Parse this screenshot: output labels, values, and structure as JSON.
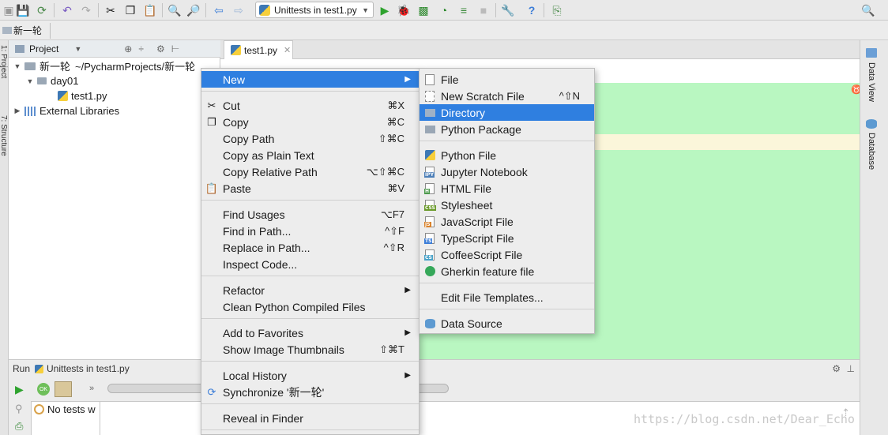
{
  "toolbar": {
    "run_config_label": "Unittests in test1.py"
  },
  "breadcrumb": {
    "label": "新一轮"
  },
  "left_strip": {
    "project_label": "1: Project",
    "structure_label": "7: Structure"
  },
  "project_panel": {
    "header_label": "Project",
    "tree": [
      {
        "label": "新一轮",
        "detail": "~/PycharmProjects/新一轮"
      },
      {
        "label": "day01"
      },
      {
        "label": "test1.py"
      },
      {
        "label": "External Libraries"
      }
    ]
  },
  "editor": {
    "tab_label": "test1.py"
  },
  "right_strip": {
    "data_view_label": "Data View",
    "database_label": "Database"
  },
  "run_panel": {
    "title": "Run",
    "config": "Unittests in test1.py",
    "status": "No tests w"
  },
  "watermark": "https://blog.csdn.net/Dear_Echo",
  "context_menu": {
    "items": [
      {
        "label": "New",
        "submenu": true,
        "highlighted": true
      },
      {
        "label": "Cut",
        "shortcut": "⌘X",
        "icon": "scissors-icon"
      },
      {
        "label": "Copy",
        "shortcut": "⌘C",
        "icon": "copy-icon"
      },
      {
        "label": "Copy Path",
        "shortcut": "⇧⌘C"
      },
      {
        "label": "Copy as Plain Text"
      },
      {
        "label": "Copy Relative Path",
        "shortcut": "⌥⇧⌘C"
      },
      {
        "label": "Paste",
        "shortcut": "⌘V",
        "icon": "paste-icon"
      },
      {
        "label": "Find Usages",
        "shortcut": "⌥F7"
      },
      {
        "label": "Find in Path...",
        "shortcut": "^⇧F"
      },
      {
        "label": "Replace in Path...",
        "shortcut": "^⇧R"
      },
      {
        "label": "Inspect Code..."
      },
      {
        "label": "Refactor",
        "submenu": true
      },
      {
        "label": "Clean Python Compiled Files"
      },
      {
        "label": "Add to Favorites",
        "submenu": true
      },
      {
        "label": "Show Image Thumbnails",
        "shortcut": "⇧⌘T"
      },
      {
        "label": "Local History",
        "submenu": true
      },
      {
        "label": "Synchronize '新一轮'",
        "icon": "sync-icon"
      },
      {
        "label": "Reveal in Finder"
      }
    ]
  },
  "new_submenu": {
    "items": [
      {
        "label": "File",
        "icon": "file-icon"
      },
      {
        "label": "New Scratch File",
        "shortcut": "^⇧N",
        "icon": "scratch-file-icon"
      },
      {
        "label": "Directory",
        "icon": "folder-icon",
        "highlighted": true
      },
      {
        "label": "Python Package",
        "icon": "package-icon"
      },
      {
        "label": "Python File",
        "icon": "python-file-icon"
      },
      {
        "label": "Jupyter Notebook",
        "icon": "jupyter-icon"
      },
      {
        "label": "HTML File",
        "icon": "html-file-icon"
      },
      {
        "label": "Stylesheet",
        "icon": "css-file-icon"
      },
      {
        "label": "JavaScript File",
        "icon": "js-file-icon"
      },
      {
        "label": "TypeScript File",
        "icon": "ts-file-icon"
      },
      {
        "label": "CoffeeScript File",
        "icon": "coffee-file-icon"
      },
      {
        "label": "Gherkin feature file",
        "icon": "gherkin-icon"
      },
      {
        "label": "Edit File Templates..."
      },
      {
        "label": "Data Source",
        "icon": "database-icon"
      }
    ]
  },
  "colors": {
    "highlight": "#2f7fe0",
    "editor_green": "#b9f7c1",
    "current_line": "#fbf6da"
  }
}
